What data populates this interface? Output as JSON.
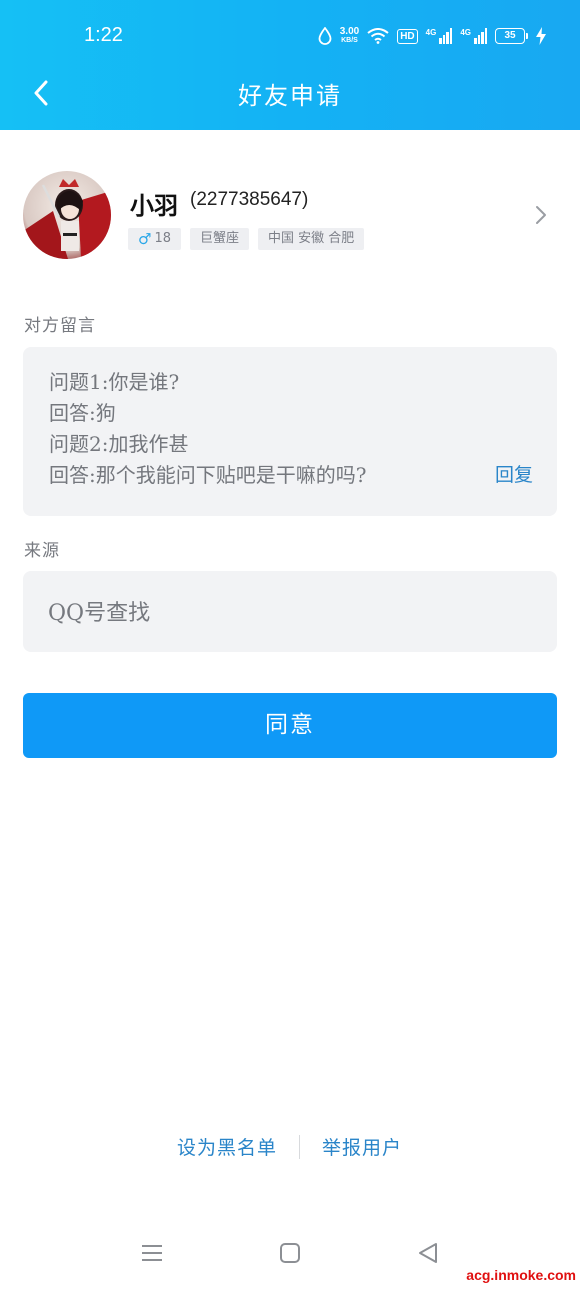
{
  "status_bar": {
    "time": "1:22",
    "speed_value": "3.00",
    "speed_unit": "KB/S",
    "hd_label": "HD",
    "signal1_label": "4G",
    "signal2_label": "4G",
    "battery": "35"
  },
  "header": {
    "title": "好友申请",
    "back_icon": "chevron-left-icon"
  },
  "profile": {
    "nickname": "小羽",
    "uin": "(2277385647)",
    "tags": {
      "gender_symbol": "♂",
      "age": "18",
      "zodiac": "巨蟹座",
      "location": "中国 安徽 合肥"
    }
  },
  "message_section": {
    "label": "对方留言",
    "lines": [
      "问题1:你是谁?",
      "回答:狗",
      "问题2:加我作甚",
      "回答:那个我能问下贴吧是干嘛的吗?"
    ],
    "reply_label": "回复"
  },
  "source_section": {
    "label": "来源",
    "value": "QQ号查找"
  },
  "actions": {
    "agree_label": "同意",
    "blacklist_label": "设为黑名单",
    "report_label": "举报用户"
  },
  "watermark": "acg.inmoke.com",
  "colors": {
    "header_gradient_start": "#15c0f5",
    "header_gradient_end": "#18a8f2",
    "primary_button": "#0f99f7",
    "link": "#2a85c9",
    "box_background": "#f2f3f5"
  }
}
